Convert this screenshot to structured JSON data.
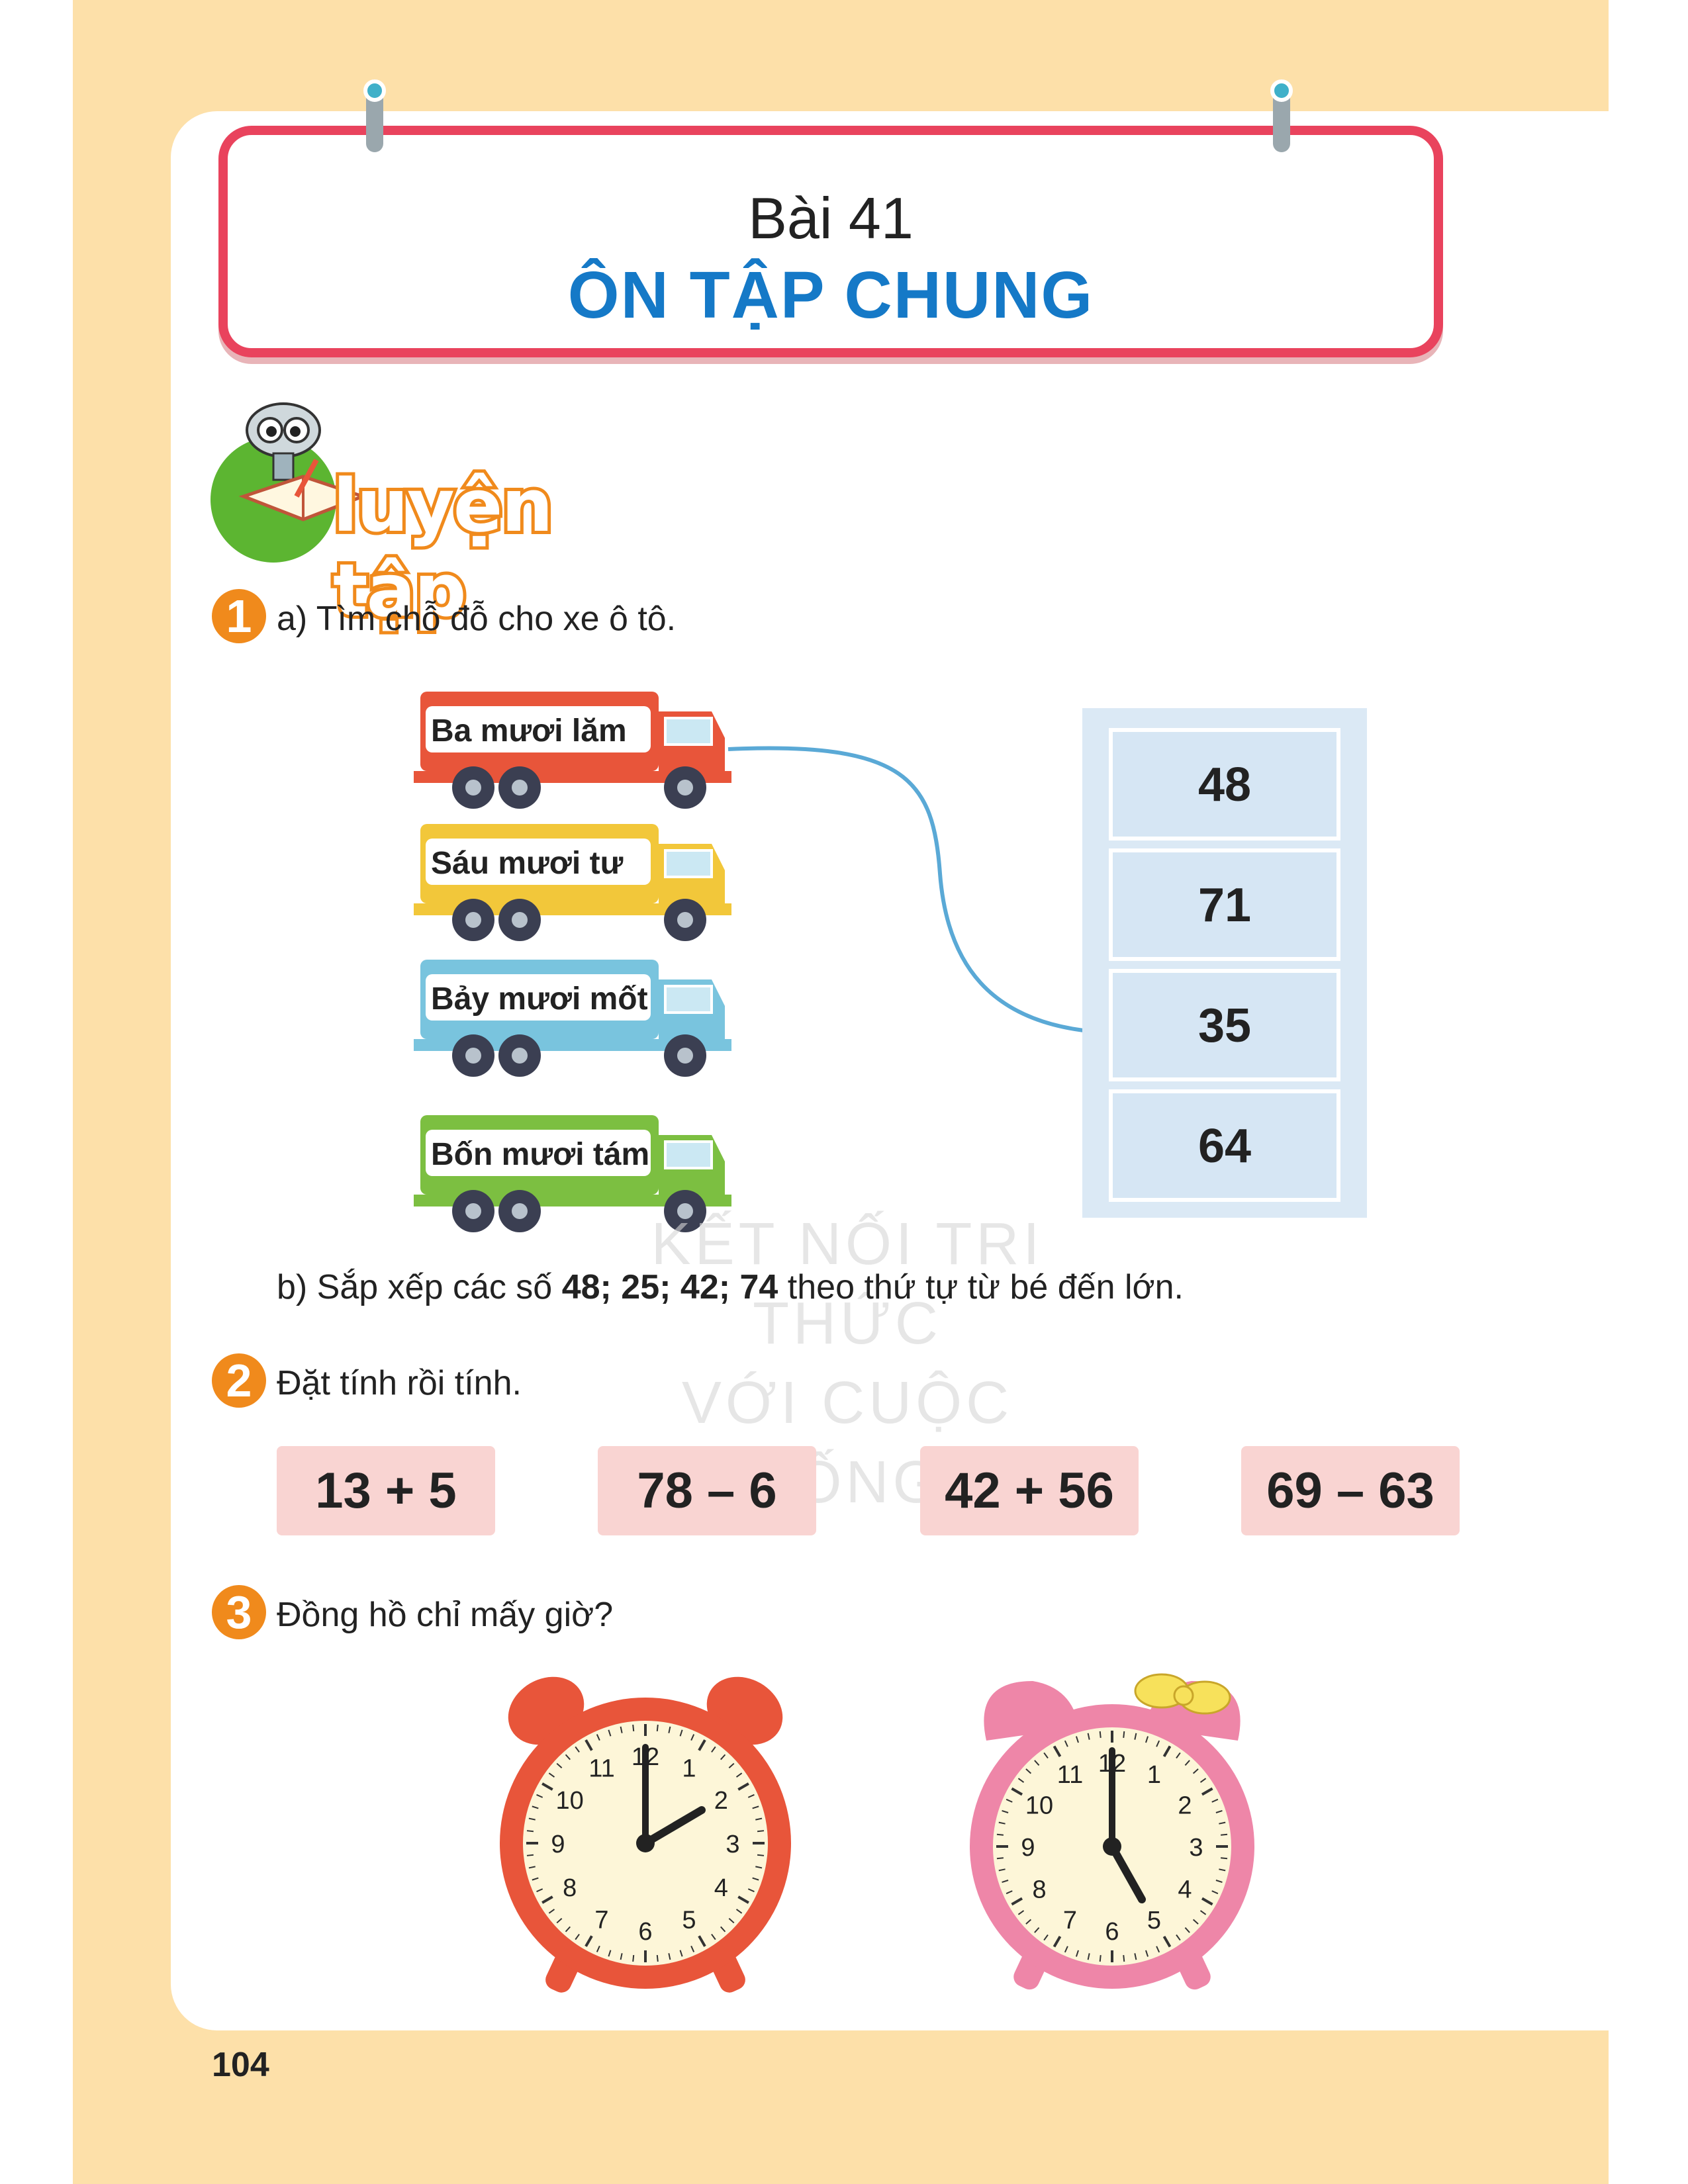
{
  "header": {
    "lesson_number": "Bài 41",
    "lesson_title": "ÔN TẬP CHUNG"
  },
  "section": {
    "label": "luyện tập"
  },
  "q1": {
    "number": "1",
    "part_a": "a) Tìm chỗ đỗ cho xe ô tô.",
    "trucks": [
      "Ba mươi lăm",
      "Sáu mươi tư",
      "Bảy mươi mốt",
      "Bốn mươi tám"
    ],
    "truck_colors": [
      "#e8553a",
      "#f2c73a",
      "#79c4de",
      "#7cbf41"
    ],
    "slots": [
      "48",
      "71",
      "35",
      "64"
    ],
    "part_b_prefix": "b) Sắp xếp các số ",
    "part_b_numbers": "48; 25; 42; 74",
    "part_b_suffix": " theo thứ tự từ bé đến lớn."
  },
  "q2": {
    "number": "2",
    "text": "Đặt tính rồi tính.",
    "expressions": [
      "13 + 5",
      "78 – 6",
      "42 + 56",
      "69 – 63"
    ]
  },
  "q3": {
    "number": "3",
    "text": "Đồng hồ chỉ mấy giờ?",
    "clock_numbers": [
      "12",
      "1",
      "2",
      "3",
      "4",
      "5",
      "6",
      "7",
      "8",
      "9",
      "10",
      "11"
    ]
  },
  "watermark": {
    "line1": "KẾT NỐI TRI THỨC",
    "line2": "VỚI CUỘC SỐNG"
  },
  "footer": {
    "page_number": "104"
  }
}
